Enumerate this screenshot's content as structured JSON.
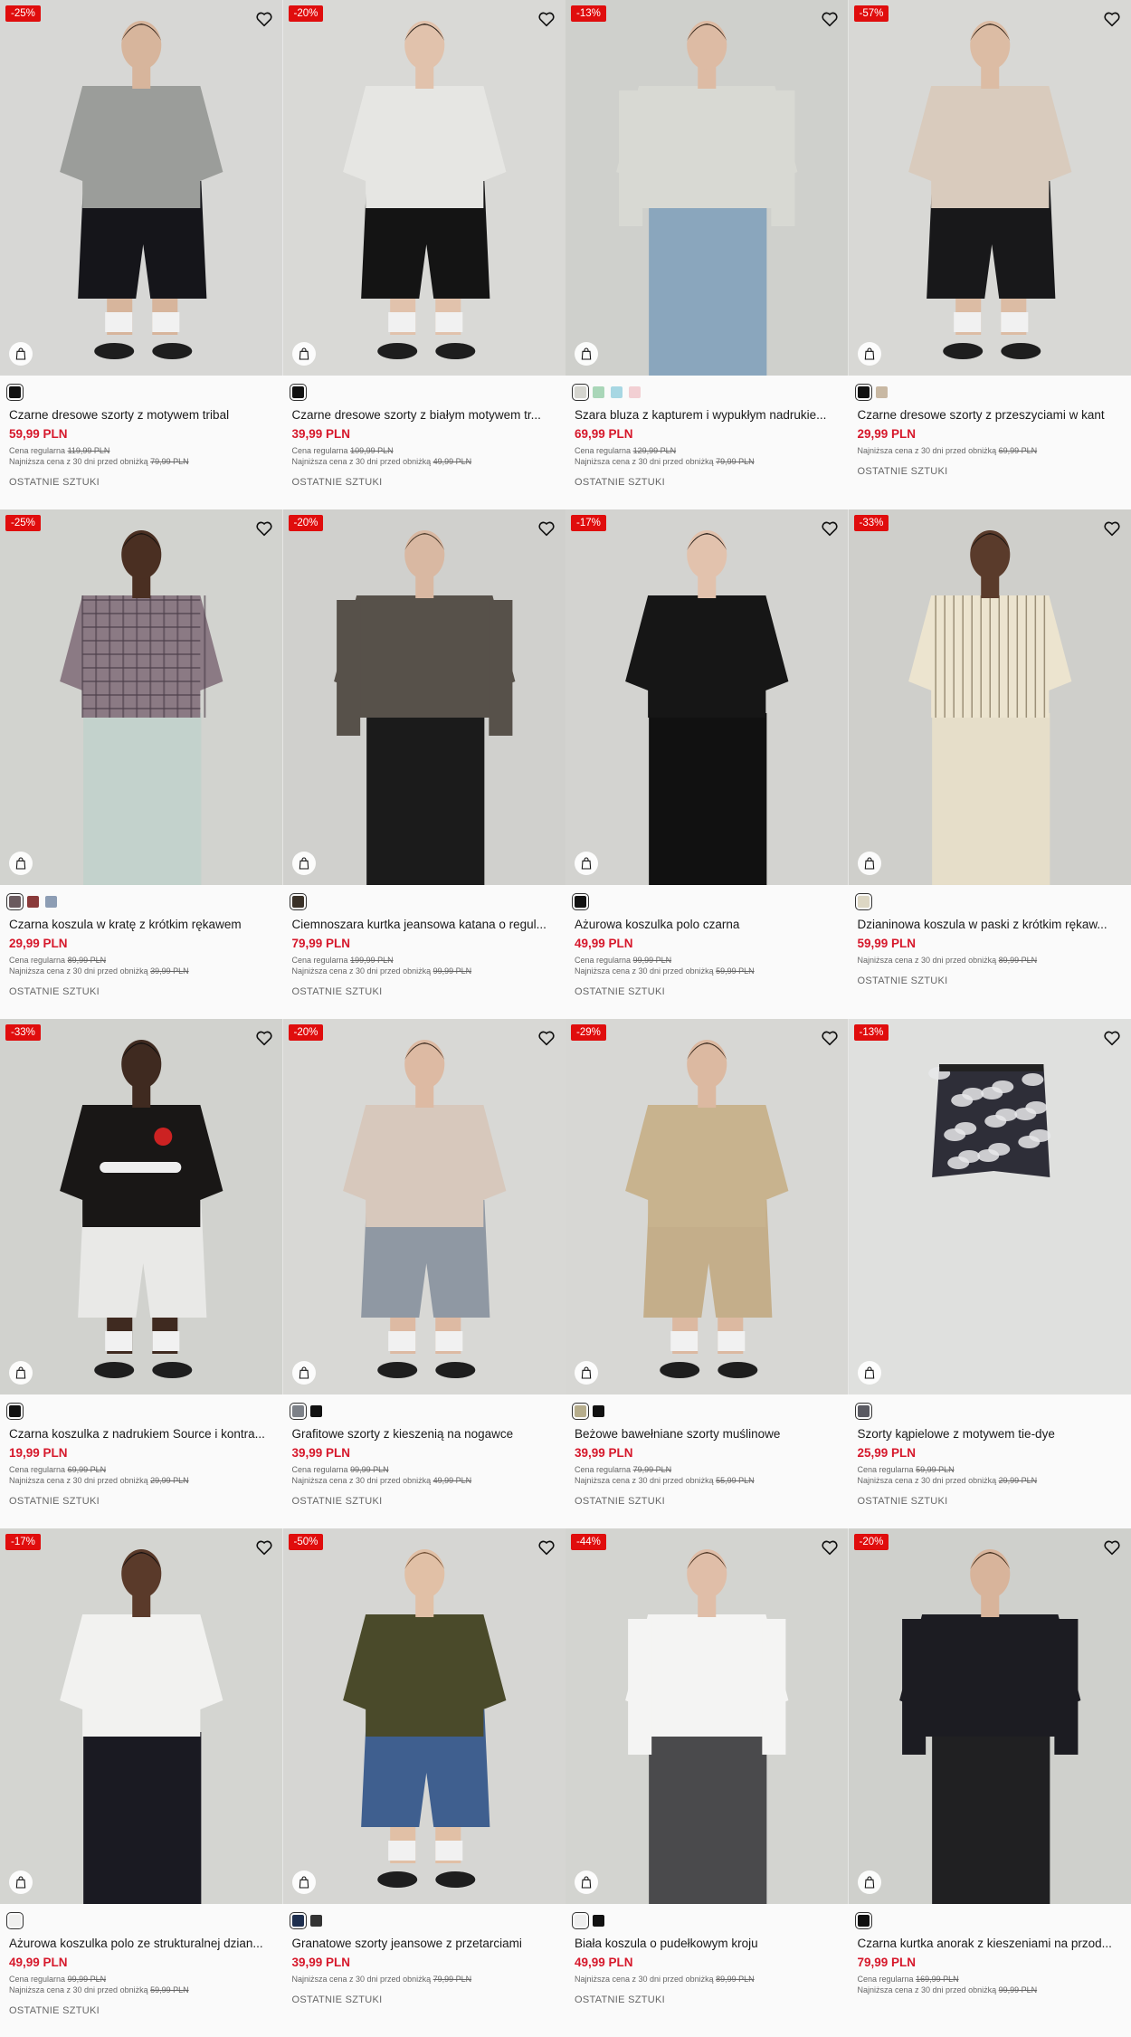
{
  "labels": {
    "regular": "Cena regularna",
    "lowest": "Najniższa cena z 30 dni przed obniżką",
    "stock": "OSTATNIE SZTUKI"
  },
  "products": [
    {
      "badge": "-25%",
      "name": "Czarne dresowe szorty z motywem tribal",
      "price": "59,99 PLN",
      "regular": "119,99 PLN",
      "lowest": "79,99 PLN",
      "stock": true,
      "swatches": [
        "#111111"
      ],
      "photo": {
        "bg": "#d7d7d5",
        "top": "#9b9d9a",
        "bottom": "#15151a",
        "skin": "#d7b59c",
        "hair": "#3a2a20",
        "type": "tee-shorts"
      }
    },
    {
      "badge": "-20%",
      "name": "Czarne dresowe szorty z białym motywem tr...",
      "price": "39,99 PLN",
      "regular": "109,99 PLN",
      "lowest": "49,99 PLN",
      "stock": true,
      "swatches": [
        "#111111"
      ],
      "photo": {
        "bg": "#d9d9d6",
        "top": "#e6e6e3",
        "bottom": "#141414",
        "skin": "#e1c2ac",
        "hair": "#2a2018",
        "type": "tee-shorts"
      }
    },
    {
      "badge": "-13%",
      "name": "Szara bluza z kapturem i wypukłym nadrukie...",
      "price": "69,99 PLN",
      "regular": "129,99 PLN",
      "lowest": "79,99 PLN",
      "stock": true,
      "swatches": [
        "#d5d5cf",
        "#a9d6b8",
        "#a7d7e3",
        "#f2cfd3"
      ],
      "photo": {
        "bg": "#cfd0cc",
        "top": "#d8d9d3",
        "bottom": "#8aa6bd",
        "skin": "#ddbba4",
        "hair": "#3b2a1d",
        "type": "hoodie"
      }
    },
    {
      "badge": "-57%",
      "name": "Czarne dresowe szorty z przeszyciami w kant",
      "price": "29,99 PLN",
      "regular": "",
      "lowest": "69,99 PLN",
      "stock": true,
      "swatches": [
        "#111111",
        "#c8b8a3"
      ],
      "photo": {
        "bg": "#d8d8d5",
        "top": "#d9cbbd",
        "bottom": "#18181a",
        "skin": "#dcbca4",
        "hair": "#342519",
        "type": "tee-shorts"
      }
    },
    {
      "badge": "-25%",
      "name": "Czarna koszula w kratę z krótkim rękawem",
      "price": "29,99 PLN",
      "regular": "89,99 PLN",
      "lowest": "39,99 PLN",
      "stock": true,
      "swatches": [
        "#6a5a5e",
        "#8a3a3a",
        "#8d9db4"
      ],
      "photo": {
        "bg": "#d2d3cf",
        "top": "#8b7a84",
        "bottom": "#c3d2cc",
        "skin": "#4a2f22",
        "hair": "#1a1410",
        "type": "check-shirt"
      }
    },
    {
      "badge": "-20%",
      "name": "Ciemnoszara kurtka jeansowa katana o regul...",
      "price": "79,99 PLN",
      "regular": "199,99 PLN",
      "lowest": "99,99 PLN",
      "stock": true,
      "swatches": [
        "#3a3128"
      ],
      "photo": {
        "bg": "#d0d0cd",
        "top": "#57514a",
        "bottom": "#1b1b1b",
        "skin": "#d9b8a2",
        "hair": "#4b3a2a",
        "type": "jacket"
      }
    },
    {
      "badge": "-17%",
      "name": "Ażurowa koszulka polo czarna",
      "price": "49,99 PLN",
      "regular": "99,99 PLN",
      "lowest": "59,99 PLN",
      "stock": true,
      "swatches": [
        "#111111"
      ],
      "photo": {
        "bg": "#d3d3d0",
        "top": "#161616",
        "bottom": "#111111",
        "skin": "#e2c2ad",
        "hair": "#2b211b",
        "type": "polo"
      }
    },
    {
      "badge": "-33%",
      "name": "Dzianinowa koszula w paski z krótkim rękaw...",
      "price": "59,99 PLN",
      "regular": "",
      "lowest": "89,99 PLN",
      "stock": true,
      "swatches": [
        "#ddd7c4"
      ],
      "photo": {
        "bg": "#cfcfcb",
        "top": "#ece4cf",
        "bottom": "#e6dec9",
        "skin": "#5a3b2b",
        "hair": "#1b1511",
        "type": "stripe-shirt"
      }
    },
    {
      "badge": "-33%",
      "name": "Czarna koszulka z nadrukiem Source i kontra...",
      "price": "19,99 PLN",
      "regular": "69,99 PLN",
      "lowest": "29,99 PLN",
      "stock": true,
      "swatches": [
        "#111111"
      ],
      "photo": {
        "bg": "#d1d2ce",
        "top": "#191716",
        "bottom": "#e9e9e7",
        "skin": "#3f2a20",
        "hair": "#121010",
        "type": "jersey"
      }
    },
    {
      "badge": "-20%",
      "name": "Grafitowe szorty z kieszenią na nogawce",
      "price": "39,99 PLN",
      "regular": "99,99 PLN",
      "lowest": "49,99 PLN",
      "stock": true,
      "swatches": [
        "#7d8188",
        "#111111"
      ],
      "photo": {
        "bg": "#d8d8d5",
        "top": "#d7c8bc",
        "bottom": "#8f98a3",
        "skin": "#ddbaa3",
        "hair": "#3c2b1f",
        "type": "tee-shorts"
      }
    },
    {
      "badge": "-29%",
      "name": "Beżowe bawełniane szorty muślinowe",
      "price": "39,99 PLN",
      "regular": "79,99 PLN",
      "lowest": "55,99 PLN",
      "stock": true,
      "swatches": [
        "#b6ad8c",
        "#111111"
      ],
      "photo": {
        "bg": "#d7d7d4",
        "top": "#c8b38e",
        "bottom": "#c4ae8a",
        "skin": "#dcb9a1",
        "hair": "#3a2a1e",
        "type": "tee-shorts"
      }
    },
    {
      "badge": "-13%",
      "name": "Szorty kąpielowe z motywem tie-dye",
      "price": "25,99 PLN",
      "regular": "59,99 PLN",
      "lowest": "29,99 PLN",
      "stock": true,
      "swatches": [
        "#5a5a62"
      ],
      "photo": {
        "bg": "#dfe0de",
        "top": "#3a3a45",
        "bottom": "#3a3a45",
        "skin": "#dfe0de",
        "hair": "#dfe0de",
        "type": "flat-shorts"
      }
    },
    {
      "badge": "-17%",
      "name": "Ażurowa koszulka polo ze strukturalnej dzian...",
      "price": "49,99 PLN",
      "regular": "99,99 PLN",
      "lowest": "59,99 PLN",
      "stock": true,
      "swatches": [
        "#efefee"
      ],
      "photo": {
        "bg": "#d4d5d1",
        "top": "#f2f2f0",
        "bottom": "#1a1a22",
        "skin": "#5a3a2a",
        "hair": "#151111",
        "type": "polo"
      }
    },
    {
      "badge": "-50%",
      "name": "Granatowe szorty jeansowe z przetarciami",
      "price": "39,99 PLN",
      "regular": "",
      "lowest": "79,99 PLN",
      "stock": true,
      "swatches": [
        "#1e2f4f",
        "#333333"
      ],
      "photo": {
        "bg": "#d6d6d3",
        "top": "#4a4a2a",
        "bottom": "#3f5f8f",
        "skin": "#e1c0a6",
        "hair": "#6b4a30",
        "type": "tee-shorts"
      }
    },
    {
      "badge": "-44%",
      "name": "Biała koszula o pudełkowym kroju",
      "price": "49,99 PLN",
      "regular": "",
      "lowest": "89,99 PLN",
      "stock": true,
      "swatches": [
        "#eeeeee",
        "#111111"
      ],
      "photo": {
        "bg": "#d3d4d0",
        "top": "#f4f4f3",
        "bottom": "#4a4a4c",
        "skin": "#e0bea8",
        "hair": "#4a3322",
        "type": "long-shirt"
      }
    },
    {
      "badge": "-20%",
      "name": "Czarna kurtka anorak z kieszeniami na przod...",
      "price": "79,99 PLN",
      "regular": "169,99 PLN",
      "lowest": "99,99 PLN",
      "stock": false,
      "swatches": [
        "#111111"
      ],
      "photo": {
        "bg": "#cfd0cc",
        "top": "#1c1c22",
        "bottom": "#202022",
        "skin": "#d8b49b",
        "hair": "#3a2818",
        "type": "jacket"
      }
    }
  ]
}
